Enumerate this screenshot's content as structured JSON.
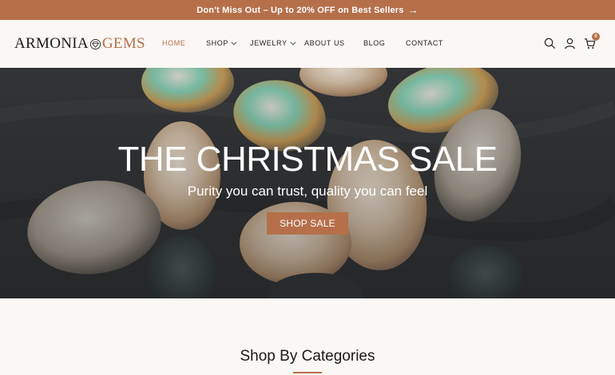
{
  "announcement": {
    "text": "Don't Miss Out – Up to 20% OFF on Best Sellers",
    "arrow_icon": "arrow-right-icon"
  },
  "logo": {
    "part1": "ARMONIA",
    "part2": "GEMS",
    "icon": "diamond-icon"
  },
  "nav": {
    "items": [
      {
        "label": "HOME",
        "active": true
      },
      {
        "label": "SHOP",
        "dropdown": true
      },
      {
        "label": "JEWELRY",
        "dropdown": true
      },
      {
        "label": "ABOUT US"
      },
      {
        "label": "BLOG"
      },
      {
        "label": "CONTACT"
      }
    ]
  },
  "header_icons": {
    "search": "search-icon",
    "account": "user-icon",
    "cart": "cart-icon",
    "cart_count": "0"
  },
  "hero": {
    "title": "THE CHRISTMAS SALE",
    "subtitle": "Purity you can trust, quality you can feel",
    "button_label": "SHOP SALE"
  },
  "section": {
    "title": "Shop By Categories"
  },
  "colors": {
    "accent": "#b5704a",
    "background": "#faf7f4"
  }
}
